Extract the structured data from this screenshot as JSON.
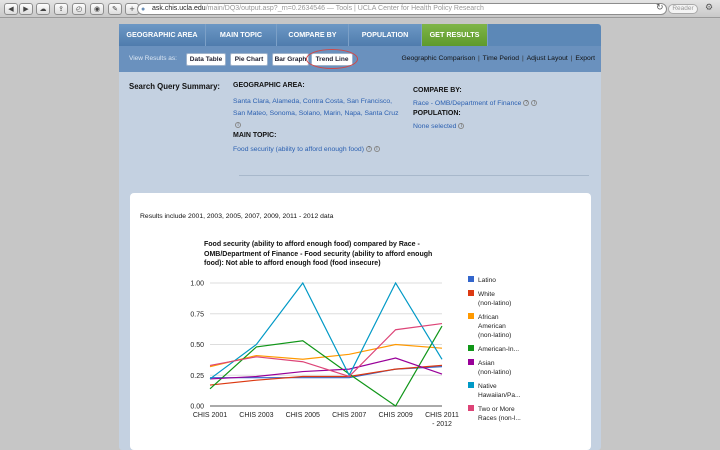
{
  "browser": {
    "url_domain": "ask.chis.ucla.edu",
    "url_path": "/main/DQ3/output.asp?_rn=0.2634546",
    "page_title": " — Tools | UCLA Center for Health Policy Research",
    "reader_label": "Reader"
  },
  "tabs": [
    {
      "label": "GEOGRAPHIC AREA"
    },
    {
      "label": "MAIN TOPIC"
    },
    {
      "label": "COMPARE BY"
    },
    {
      "label": "POPULATION"
    },
    {
      "label": "GET RESULTS"
    }
  ],
  "view_results": {
    "label": "View Results as:",
    "buttons": [
      "Data Table",
      "Pie Chart",
      "Bar Graph",
      "Trend Line"
    ],
    "links": [
      "Geographic Comparison",
      "Time Period",
      "Adjust Layout",
      "Export"
    ]
  },
  "summary": {
    "title": "Search Query Summary:",
    "geo_label": "GEOGRAPHIC AREA:",
    "geo_line1": "Santa Clara, Alameda, Contra Costa, San Francisco,",
    "geo_line2": "San Mateo, Sonoma, Solano, Marin, Napa, Santa Cruz",
    "topic_label": "MAIN TOPIC:",
    "topic_value": "Food security (ability to afford enough food)",
    "compare_label": "COMPARE BY:",
    "compare_value": "Race - OMB/Department of Finance",
    "population_label": "POPULATION:",
    "population_value": "None selected"
  },
  "results": {
    "note": "Results include 2001, 2003, 2005, 2007, 2009, 2011 - 2012 data"
  },
  "chart_data": {
    "type": "line",
    "title": "Food security (ability to afford enough food) compared by Race - OMB/Department of Finance - Food security (ability to afford enough food): Not able to afford enough food (food insecure)",
    "categories": [
      "CHIS 2001",
      "CHIS 2003",
      "CHIS 2005",
      "CHIS 2007",
      "CHIS 2009",
      "CHIS 2011 - 2012"
    ],
    "yticks": [
      "1.00",
      "0.75",
      "0.50",
      "0.25",
      "0.00"
    ],
    "ylim": [
      0,
      1
    ],
    "grid": true,
    "legend_position": "right",
    "series": [
      {
        "name": "Latino",
        "color": "#3366cc",
        "values": [
          0.23,
          0.23,
          0.23,
          0.23,
          0.3,
          0.32
        ]
      },
      {
        "name": "White (non-latino)",
        "color": "#dc3912",
        "values": [
          0.17,
          0.21,
          0.24,
          0.24,
          0.3,
          0.33
        ]
      },
      {
        "name": "African American (non-latino)",
        "color": "#ff9900",
        "values": [
          0.32,
          0.41,
          0.38,
          0.42,
          0.5,
          0.47
        ]
      },
      {
        "name": "American-In...",
        "color": "#109618",
        "values": [
          0.14,
          0.48,
          0.53,
          0.26,
          0.0,
          0.65
        ]
      },
      {
        "name": "Asian (non-latino)",
        "color": "#990099",
        "values": [
          0.22,
          0.24,
          0.28,
          0.3,
          0.39,
          0.26
        ]
      },
      {
        "name": "Native Hawaiian/Pa...",
        "color": "#0099c6",
        "values": [
          0.22,
          0.5,
          1.0,
          0.25,
          1.0,
          0.38
        ]
      },
      {
        "name": "Two or More Races (non-l...",
        "color": "#dd4477",
        "values": [
          0.33,
          0.4,
          0.36,
          0.24,
          0.62,
          0.67
        ]
      }
    ],
    "legend_lines": [
      [
        "Latino"
      ],
      [
        "White",
        "(non-latino)"
      ],
      [
        "African",
        "American",
        "(non-latino)"
      ],
      [
        "American-In..."
      ],
      [
        "Asian",
        "(non-latino)"
      ],
      [
        "Native",
        "Hawaiian/Pa..."
      ],
      [
        "Two or More",
        "Races (non-l..."
      ]
    ]
  }
}
